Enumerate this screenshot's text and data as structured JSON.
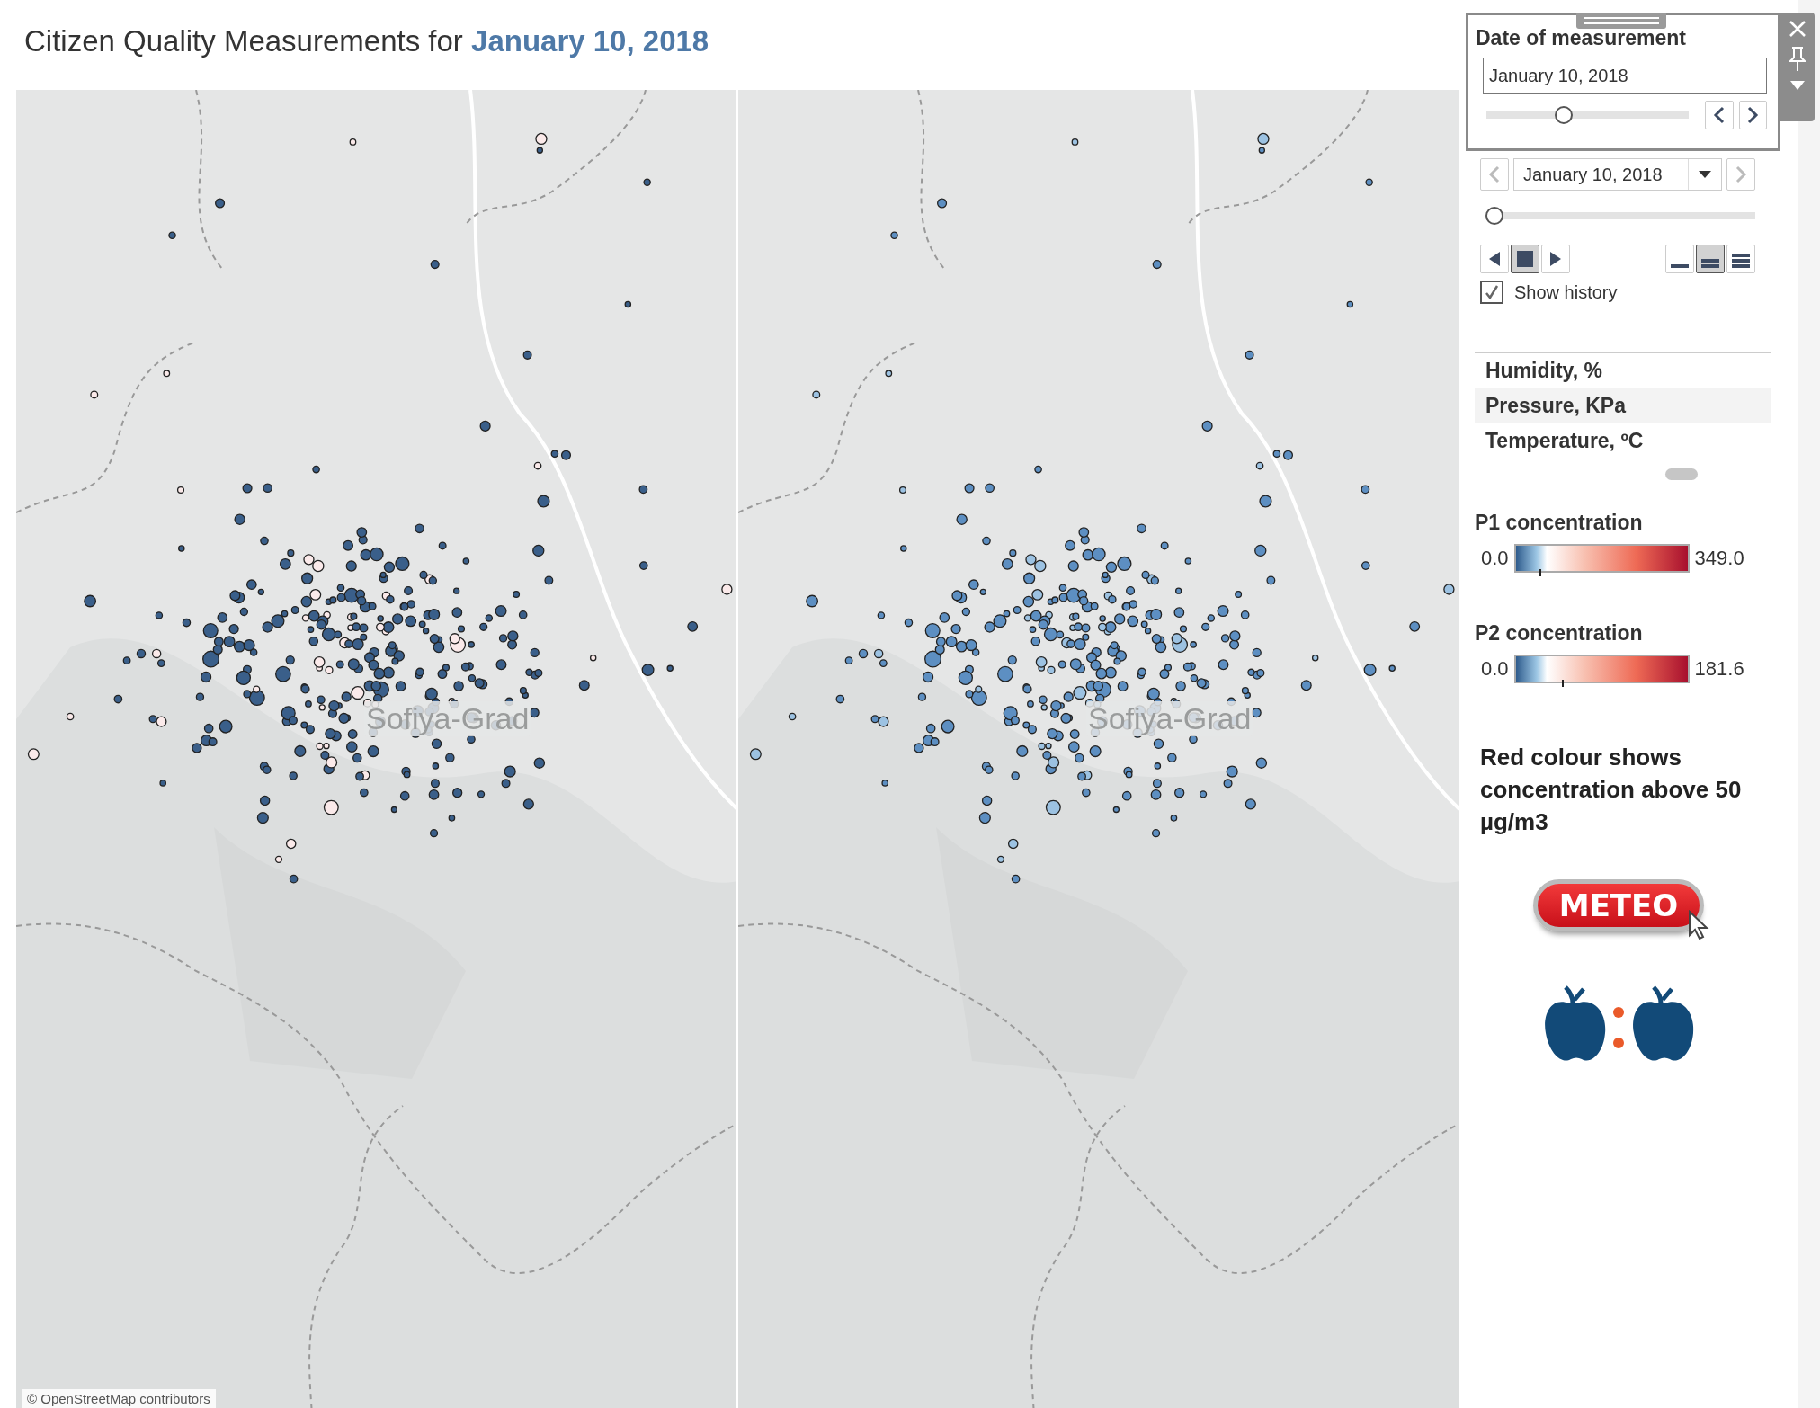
{
  "title": {
    "text": "Citizen Quality Measurements for",
    "date": "January 10, 2018"
  },
  "maps": [
    {
      "kind": "p1",
      "place_label": "Sofiya-Grad",
      "attribution": "© OpenStreetMap contributors"
    },
    {
      "kind": "p2",
      "place_label": "Sofiya-Grad"
    }
  ],
  "date_popup": {
    "title": "Date of measurement",
    "value": "January 10, 2018",
    "level": 0.37
  },
  "page_control": {
    "value": "January 10, 2018",
    "level": 0,
    "playback": [
      {
        "kind": "back",
        "selected": false
      },
      {
        "kind": "stop",
        "selected": true
      },
      {
        "kind": "forward",
        "selected": false
      }
    ],
    "speeds": [
      {
        "kind": "slow",
        "selected": false
      },
      {
        "kind": "normal",
        "selected": true
      },
      {
        "kind": "fast",
        "selected": false
      }
    ],
    "show_history": {
      "label": "Show history",
      "checked": true
    }
  },
  "measures": [
    {
      "label": "Humidity, %",
      "selected": false
    },
    {
      "label": "Pressure, KPa",
      "selected": true
    },
    {
      "label": "Temperature, ºC",
      "selected": false
    }
  ],
  "legends": [
    {
      "title": "P1 concentration",
      "min": "0.0",
      "max": "349.0",
      "level": 0.14
    },
    {
      "title": "P2 concentration",
      "min": "0.0",
      "max": "181.6",
      "level": 0.27
    }
  ],
  "note": "Red colour shows concentration above 50 µg/m3",
  "meteo_button": {
    "label": "METEO"
  }
}
